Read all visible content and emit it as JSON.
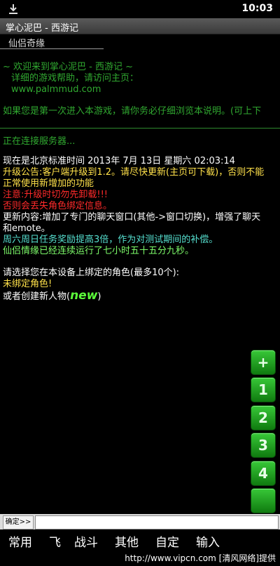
{
  "status": {
    "time": "10:03"
  },
  "window": {
    "title": "掌心泥巴 - 西游记"
  },
  "tab": {
    "label": "仙侣奇缘"
  },
  "welcome": {
    "line1": "~ 欢迎来到掌心泥巴 - 西游记 ~",
    "line2": "详细的游戏帮助，请访问主页：",
    "line3": "www.palmmud.com",
    "line4": "如果您是第一次进入本游戏，请你务必仔细浏览本说明。(可上下"
  },
  "connecting": "正在连接服务器...",
  "messages": {
    "time_line": "现在是北京标准时间 2013年 7月 13日 星期六 02:03:14",
    "upgrade_line1": "升级公告:客户端升级到1.2。请尽快更新(主页可下载)，否则不能",
    "upgrade_line2": "正常使用新增加的功能",
    "warn_line1": "注意:升级时切勿先卸载!!!",
    "warn_line2": "否则会丢失角色绑定信息。",
    "update_line1": "更新内容:增加了专门的聊天窗口(其他->窗口切换)，增强了聊天",
    "update_line2": "和emote。",
    "weekend_line": "周六周日任务奖励提高3倍，作为对测试期间的补偿。",
    "uptime_line": "仙侣情缘已经连续运行了七小时五十五分九秒。",
    "choose_line": "请选择您在本设备上绑定的角色(最多10个):",
    "none_line": "未绑定角色!",
    "create_prefix": "或者创建新人物(",
    "create_new": "new",
    "create_suffix": ")"
  },
  "side_buttons": [
    "+",
    "1",
    "2",
    "3",
    "4",
    ""
  ],
  "input": {
    "confirm_label": "确定>>",
    "value": ""
  },
  "bottom_menu": [
    "常用",
    "飞",
    "战斗",
    "其他",
    "自定",
    "输入"
  ],
  "watermark": "http://www.vipcn.com [清风网络]提供",
  "colors": {
    "accent": "#1f9e1f",
    "notice": "#ffe14a",
    "warning": "#ff2a2a"
  }
}
